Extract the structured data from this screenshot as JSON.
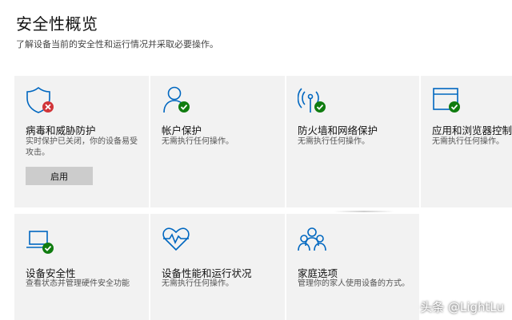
{
  "header": {
    "title": "安全性概览",
    "subtitle": "了解设备当前的安全性和运行情况并采取必要操作。"
  },
  "cards": [
    {
      "title": "病毒和威胁防护",
      "desc_line1": "实时保护已关闭，你的设备易受",
      "desc_line2": "攻击。",
      "button_label": "启用",
      "status": "error"
    },
    {
      "title": "帐户保护",
      "desc_line1": "无需执行任何操作。",
      "status": "ok"
    },
    {
      "title": "防火墙和网络保护",
      "desc_line1": "无需执行任何操作。",
      "status": "ok"
    },
    {
      "title": "应用和浏览器控制",
      "desc_line1": "无需执行任何操作。",
      "status": "ok"
    },
    {
      "title": "设备安全性",
      "desc_line1": "查看状态并管理硬件安全功能",
      "status": "ok"
    },
    {
      "title": "设备性能和运行状况",
      "desc_line1": "无需执行任何操作。",
      "status": "ok"
    },
    {
      "title": "家庭选项",
      "desc_line1": "管理你的家人使用设备的方式。"
    }
  ],
  "icons": {
    "virus": "shield-icon",
    "account": "person-icon",
    "firewall": "antenna-icon",
    "app": "browser-window-icon",
    "device": "laptop-icon",
    "health": "heart-pulse-icon",
    "family": "family-icon"
  },
  "colors": {
    "accent": "#0067c0",
    "ok": "#107c10",
    "error": "#d13438",
    "card_bg": "#f2f2f2"
  },
  "watermark": "头条 @LightLu"
}
